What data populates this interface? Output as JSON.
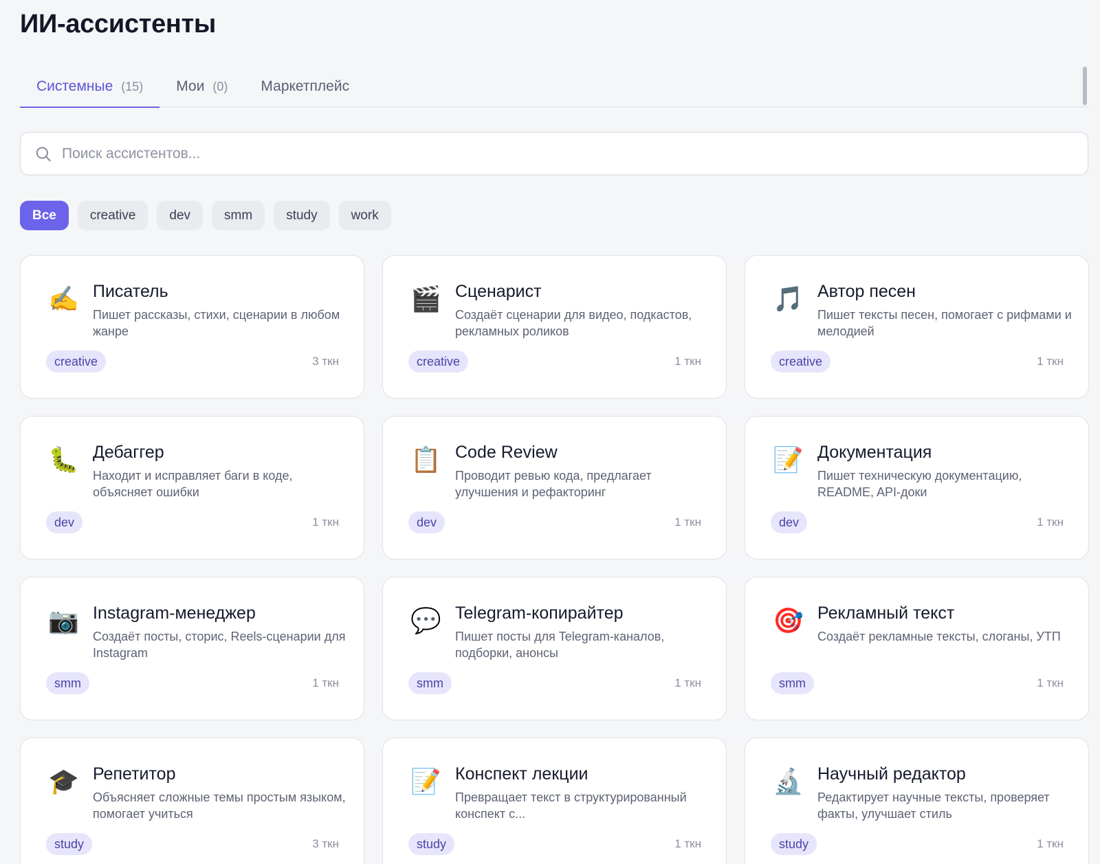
{
  "header": {
    "title": "ИИ-ассистенты"
  },
  "tabs": [
    {
      "label": "Системные",
      "count": "(15)",
      "active": true
    },
    {
      "label": "Мои",
      "count": "(0)",
      "active": false
    },
    {
      "label": "Маркетплейс",
      "count": "",
      "active": false
    }
  ],
  "search": {
    "placeholder": "Поиск ассистентов...",
    "value": "",
    "icon": "search-icon"
  },
  "filters": [
    {
      "label": "Все",
      "active": true
    },
    {
      "label": "creative",
      "active": false
    },
    {
      "label": "dev",
      "active": false
    },
    {
      "label": "smm",
      "active": false
    },
    {
      "label": "study",
      "active": false
    },
    {
      "label": "work",
      "active": false
    }
  ],
  "assistants": [
    {
      "emoji": "✍️",
      "icon": "writing-hand-icon",
      "title": "Писатель",
      "description": "Пишет рассказы, стихи, сценарии в любом жанре",
      "tag": "creative",
      "cost": "3 ткн"
    },
    {
      "emoji": "🎬",
      "icon": "clapper-board-icon",
      "title": "Сценарист",
      "description": "Создаёт сценарии для видео, подкастов, рекламных роликов",
      "tag": "creative",
      "cost": "1 ткн"
    },
    {
      "emoji": "🎵",
      "icon": "music-note-icon",
      "title": "Автор песен",
      "description": "Пишет тексты песен, помогает с рифмами и мелодией",
      "tag": "creative",
      "cost": "1 ткн"
    },
    {
      "emoji": "🐛",
      "icon": "bug-icon",
      "title": "Дебаггер",
      "description": "Находит и исправляет баги в коде, объясняет ошибки",
      "tag": "dev",
      "cost": "1 ткн"
    },
    {
      "emoji": "📋",
      "icon": "clipboard-icon",
      "title": "Code Review",
      "description": "Проводит ревью кода, предлагает улучшения и рефакторинг",
      "tag": "dev",
      "cost": "1 ткн"
    },
    {
      "emoji": "📝",
      "icon": "memo-icon",
      "title": "Документация",
      "description": "Пишет техническую документацию, README, API-доки",
      "tag": "dev",
      "cost": "1 ткн"
    },
    {
      "emoji": "📷",
      "icon": "camera-icon",
      "title": "Instagram-менеджер",
      "description": "Создаёт посты, сторис, Reels-сценарии для Instagram",
      "tag": "smm",
      "cost": "1 ткн"
    },
    {
      "emoji": "💬",
      "icon": "speech-bubble-icon",
      "title": "Telegram-копирайтер",
      "description": "Пишет посты для Telegram-каналов, подборки, анонсы",
      "tag": "smm",
      "cost": "1 ткн"
    },
    {
      "emoji": "🎯",
      "icon": "target-icon",
      "title": "Рекламный текст",
      "description": "Создаёт рекламные тексты, слоганы, УТП",
      "tag": "smm",
      "cost": "1 ткн"
    },
    {
      "emoji": "🎓",
      "icon": "graduation-cap-icon",
      "title": "Репетитор",
      "description": "Объясняет сложные темы простым языком, помогает учиться",
      "tag": "study",
      "cost": "3 ткн"
    },
    {
      "emoji": "📝",
      "icon": "memo-icon",
      "title": "Конспект лекции",
      "description": "Превращает текст в структурированный конспект с...",
      "tag": "study",
      "cost": "1 ткн"
    },
    {
      "emoji": "🔬",
      "icon": "microscope-icon",
      "title": "Научный редактор",
      "description": "Редактирует научные тексты, проверяет факты, улучшает стиль",
      "tag": "study",
      "cost": "1 ткн"
    }
  ]
}
